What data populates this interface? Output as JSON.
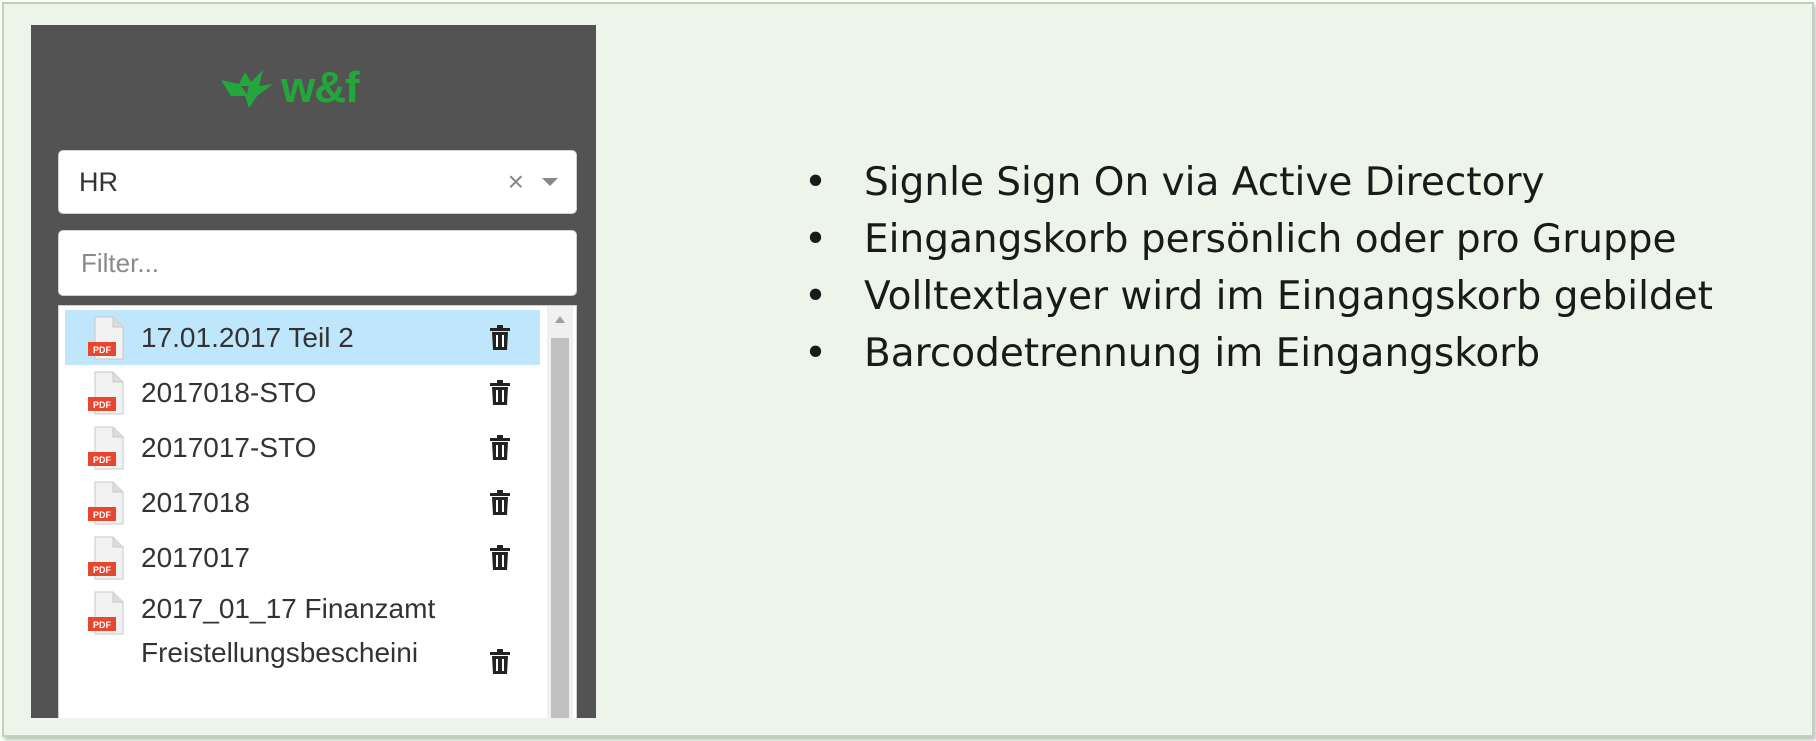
{
  "app": {
    "logo_text": "w&f",
    "brand_color": "#22a83a",
    "select": {
      "value": "HR",
      "clear_symbol": "×"
    },
    "filter": {
      "placeholder": "Filter..."
    },
    "files": [
      {
        "label": "17.01.2017 Teil 2",
        "selected": true
      },
      {
        "label": "2017018-STO",
        "selected": false
      },
      {
        "label": "2017017-STO",
        "selected": false
      },
      {
        "label": "2017018",
        "selected": false
      },
      {
        "label": "2017017",
        "selected": false
      },
      {
        "label": "2017_01_17 Finanzamt Freistellungsbescheini",
        "selected": false
      }
    ],
    "file_icon_label": "PDF"
  },
  "bullets": [
    "Signle Sign On via Active Directory",
    "Eingangskorb persönlich oder pro Gruppe",
    "Volltextlayer wird im Eingangskorb gebildet",
    "Barcodetrennung im Eingangskorb"
  ]
}
